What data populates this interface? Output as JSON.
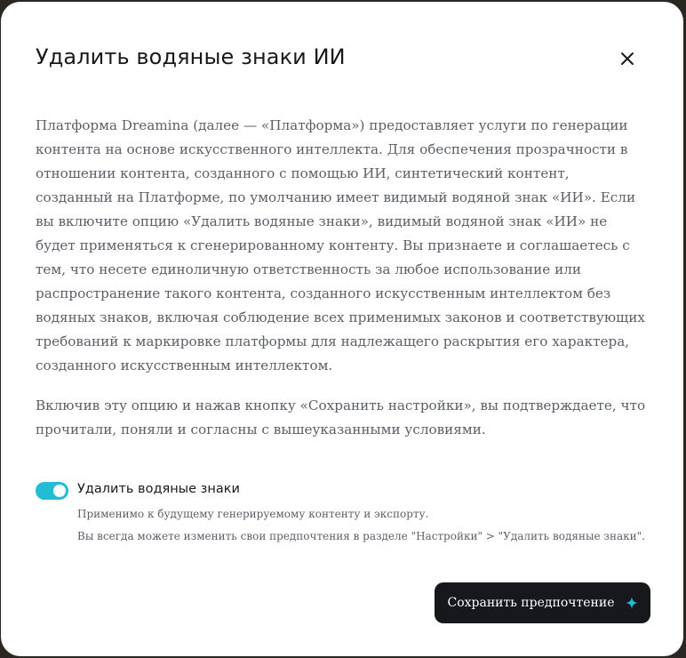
{
  "dialog": {
    "title": "Удалить водяные знаки ИИ",
    "close_icon": "close-icon",
    "paragraph_1": "Платформа Dreamina (далее — «Платформа») предоставляет услуги по генерации контента на основе искусственного интеллекта. Для обеспечения прозрачности в отношении контента, созданного с помощью ИИ, синтетический контент, созданный на Платформе, по умолчанию имеет видимый водяной знак «ИИ». Если  вы включите опцию «Удалить водяные знаки», видимый водяной знак «ИИ» не будет применяться к сгенерированному контенту. Вы признаете и соглашаетесь с тем, что несете единоличную ответственность за любое использование или распространение такого контента, созданного искусственным интеллектом без водяных знаков, включая соблюдение всех применимых законов и соответствующих требований к маркировке платформы для надлежащего раскрытия его характера, созданного искусственным интеллектом.",
    "paragraph_2": "Включив эту опцию и нажав кнопку «Сохранить настройки», вы подтверждаете, что прочитали, поняли и согласны с вышеуказанными условиями.",
    "toggle": {
      "label": "Удалить водяные знаки",
      "checked": true,
      "color": "#22bdd4"
    },
    "hint_1": "Применимо к будущему генерируемому контенту и экспорту.",
    "hint_2": "Вы всегда можете изменить свои предпочтения в разделе \"Настройки\" > \"Удалить водяные знаки\".",
    "save_button": {
      "label": "Сохранить предпочтение",
      "icon": "sparkle-icon",
      "icon_color": "#22bdd4"
    }
  }
}
